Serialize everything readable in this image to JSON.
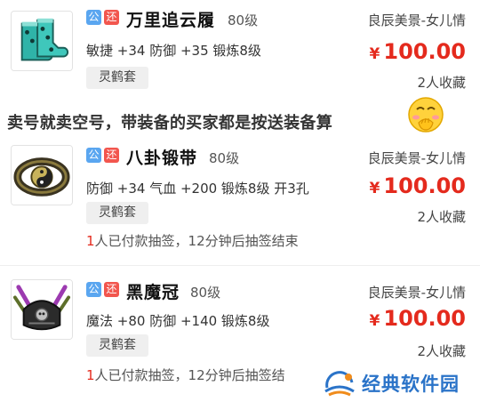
{
  "listings": [
    {
      "icon": "boots-icon",
      "badge_public": "公",
      "badge_return": "还",
      "name": "万里追云履",
      "level": "80级",
      "server": "良辰美景-女儿情",
      "stats": "敏捷 +34 防御 +35 锻炼8级",
      "price_symbol": "¥",
      "price": "100.00",
      "favorites": "2人收藏",
      "tag": "灵鹤套"
    },
    {
      "icon": "belt-icon",
      "badge_public": "公",
      "badge_return": "还",
      "name": "八卦锻带",
      "level": "80级",
      "server": "良辰美景-女儿情",
      "stats": "防御 +34 气血 +200 锻炼8级 开3孔",
      "price_symbol": "¥",
      "price": "100.00",
      "favorites": "2人收藏",
      "tag": "灵鹤套",
      "lottery_count": "1",
      "lottery_text": "人已付款抽签，12分钟后抽签结束"
    },
    {
      "icon": "helmet-icon",
      "badge_public": "公",
      "badge_return": "还",
      "name": "黑魔冠",
      "level": "80级",
      "server": "良辰美景-女儿情",
      "stats": "魔法 +80 防御 +140 锻炼8级",
      "price_symbol": "¥",
      "price": "100.00",
      "favorites": "2人收藏",
      "tag": "灵鹤套",
      "lottery_count": "1",
      "lottery_text": "人已付款抽签，12分钟后抽签结"
    }
  ],
  "overlay_caption": "卖号就卖空号，带装备的买家都是按送装备算",
  "watermark": {
    "text": "经典软件园"
  },
  "colors": {
    "price": "#e42a1d",
    "badge_public": "#5aa6f0",
    "badge_return": "#f2564e",
    "tag_bg": "#efefef"
  }
}
